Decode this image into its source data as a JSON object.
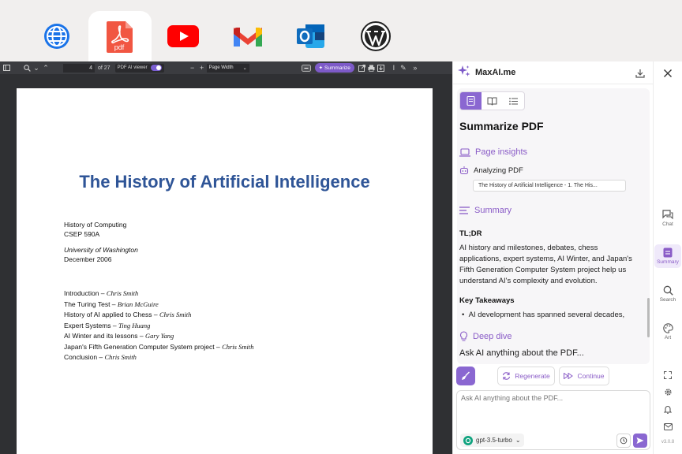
{
  "dock": {
    "items": [
      {
        "name": "browser",
        "label": ""
      },
      {
        "name": "pdf",
        "label": "pdf",
        "active": true
      },
      {
        "name": "youtube",
        "label": ""
      },
      {
        "name": "gmail",
        "label": ""
      },
      {
        "name": "outlook",
        "label": ""
      },
      {
        "name": "wordpress",
        "label": ""
      }
    ]
  },
  "pdf_toolbar": {
    "page_current": "4",
    "page_total": "of 27",
    "ai_viewer_label": "PDF AI viewer",
    "zoom_value": "Page Width",
    "summarize_label": "Summarize"
  },
  "document": {
    "title": "The History of Artificial Intelligence",
    "course_lines": [
      "History of Computing",
      "CSEP 590A"
    ],
    "institution": "University of Washington",
    "date": "December 2006",
    "toc": [
      {
        "topic": "Introduction – ",
        "author": "Chris Smith"
      },
      {
        "topic": "The Turing Test – ",
        "author": "Brian McGuire"
      },
      {
        "topic": "History of AI applied to Chess – ",
        "author": "Chris Smith"
      },
      {
        "topic": "Expert Systems – ",
        "author": "Ting Huang"
      },
      {
        "topic": "AI Winter and its lessons – ",
        "author": "Gary Yang"
      },
      {
        "topic": "Japan's Fifth Generation Computer System project – ",
        "author": "Chris Smith"
      },
      {
        "topic": "Conclusion – ",
        "author": "Chris Smith"
      }
    ]
  },
  "panel": {
    "brand": "MaxAI.me",
    "heading": "Summarize PDF",
    "page_insights_label": "Page insights",
    "analyzing_label": "Analyzing PDF",
    "source_chip": "The History of Artificial Intelligence - 1. The His...",
    "summary_label": "Summary",
    "tldr_heading": "TL;DR",
    "tldr_text": "AI history and milestones, debates, chess applications, expert systems, AI Winter, and Japan's Fifth Generation Computer System project help us understand AI's complexity and evolution.",
    "takeaways_heading": "Key Takeaways",
    "takeaway_1": "AI development has spanned several decades,",
    "deep_dive_label": "Deep dive",
    "ask_line": "Ask AI anything about the PDF...",
    "regenerate_label": "Regenerate",
    "continue_label": "Continue",
    "input_placeholder": "Ask AI anything about the PDF...",
    "model_label": "gpt-3.5-turbo"
  },
  "rail": {
    "chat_label": "Chat",
    "summary_label": "Summary",
    "search_label": "Search",
    "art_label": "Art",
    "version": "v3.0.8"
  },
  "colors": {
    "accent": "#8a67d1",
    "title_blue": "#2f5597",
    "youtube_red": "#ff0000",
    "pdf_red": "#f15642",
    "outlook_blue": "#0f6cbd"
  }
}
